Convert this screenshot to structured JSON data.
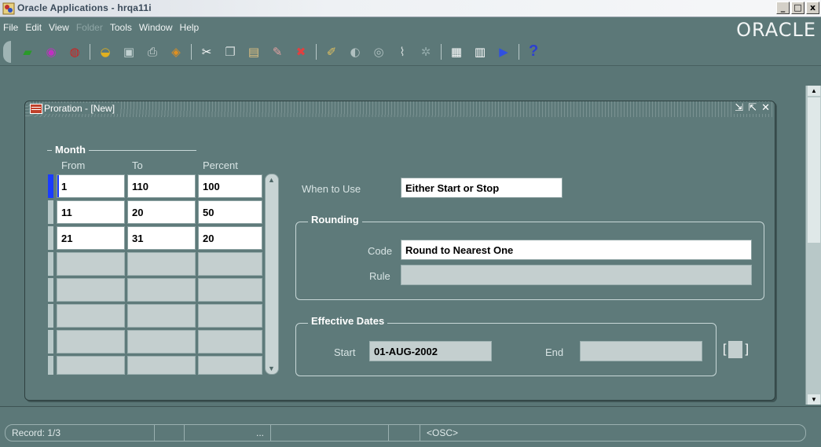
{
  "window": {
    "title": "Oracle Applications - hrqa11i",
    "minimize": "_",
    "maximize": "□",
    "close": "x"
  },
  "menu": {
    "items": [
      {
        "label": "File",
        "disabled": false
      },
      {
        "label": "Edit",
        "disabled": false
      },
      {
        "label": "View",
        "disabled": false
      },
      {
        "label": "Folder",
        "disabled": true
      },
      {
        "label": "Tools",
        "disabled": false
      },
      {
        "label": "Window",
        "disabled": false
      },
      {
        "label": "Help",
        "disabled": false
      }
    ],
    "brand": "ORACLE"
  },
  "toolbar": {
    "help": "?"
  },
  "form": {
    "title": "Proration - [New]",
    "ctrl_min": "⇲",
    "ctrl_max": "⇱",
    "ctrl_close": "✕",
    "month_group": "Month",
    "col_from": "From",
    "col_to": "To",
    "col_percent": "Percent",
    "rows": [
      {
        "from": "1",
        "to": "110",
        "percent": "100"
      },
      {
        "from": "11",
        "to": "20",
        "percent": "50"
      },
      {
        "from": "21",
        "to": "31",
        "percent": "20"
      }
    ],
    "when_to_use_label": "When to Use",
    "when_to_use_value": "Either Start or Stop",
    "rounding_group": "Rounding",
    "code_label": "Code",
    "code_value": "Round to Nearest One",
    "rule_label": "Rule",
    "rule_value": "",
    "effective_group": "Effective Dates",
    "start_label": "Start",
    "start_value": "01-AUG-2002",
    "end_label": "End",
    "end_value": ""
  },
  "status": {
    "record": "Record: 1/3",
    "ellipsis": "...",
    "osc": "<OSC>"
  },
  "colors": {
    "background": "#5a7676",
    "cursor": "#1a3cff"
  }
}
